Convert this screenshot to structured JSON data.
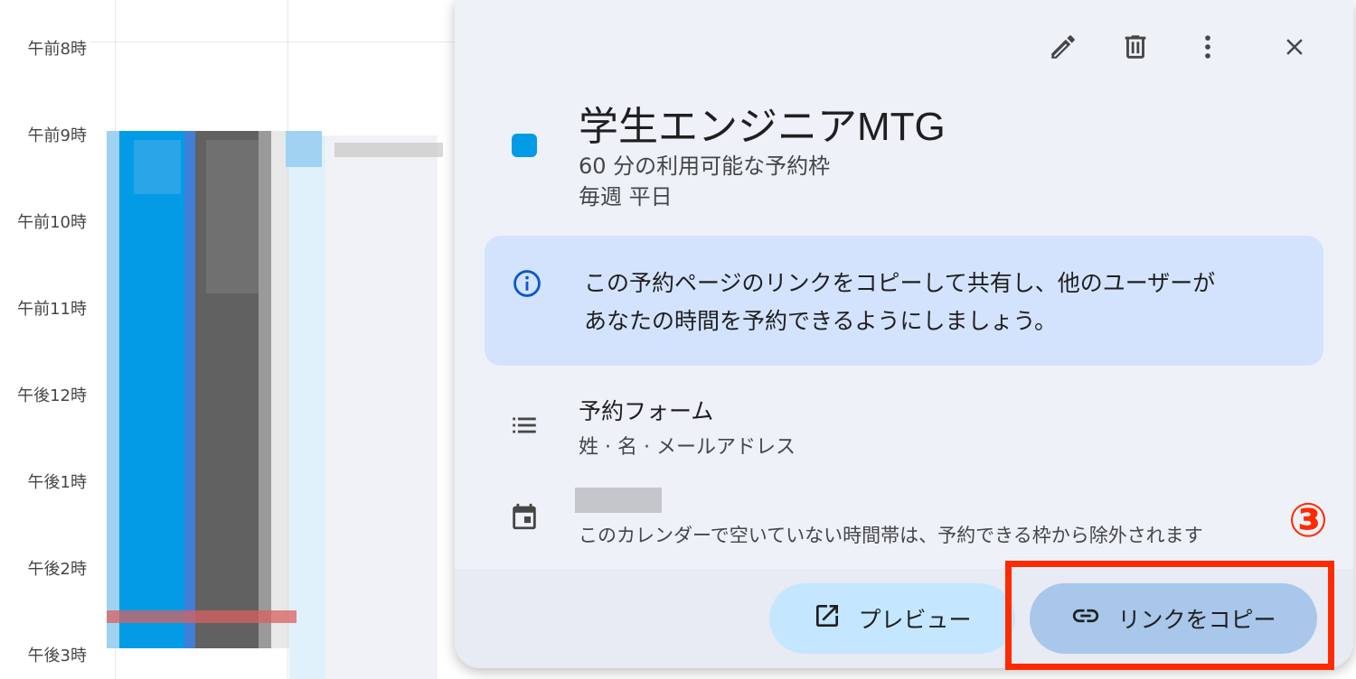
{
  "calendar": {
    "times": [
      "午前8時",
      "午前9時",
      "午前10時",
      "午前11時",
      "午後12時",
      "午後1時",
      "午後2時",
      "午後3時"
    ]
  },
  "popup": {
    "toolbar": {
      "edit_icon": "pencil-icon",
      "delete_icon": "trash-icon",
      "more_icon": "more-vert-icon",
      "close_icon": "close-icon"
    },
    "color": "#039be5",
    "title": "学生エンジニアMTG",
    "slot_description": "60 分の利用可能な予約枠",
    "recurrence": "毎週 平日",
    "info": {
      "icon": "info-icon",
      "text_line1": "この予約ページのリンクをコピーして共有し、他のユーザーが",
      "text_line2": "あなたの時間を予約できるようにしましょう。"
    },
    "booking_form": {
      "icon": "list-icon",
      "label": "予約フォーム",
      "fields": "姓 · 名 · メールアドレス"
    },
    "calendar_section": {
      "icon": "calendar-icon",
      "note": "このカレンダーで空いていない時間帯は、予約できる枠から除外されます"
    },
    "buttons": {
      "preview_label": "プレビュー",
      "copy_label": "リンクをコピー"
    }
  },
  "annotation": {
    "number": "③",
    "color": "#ff2a00"
  }
}
